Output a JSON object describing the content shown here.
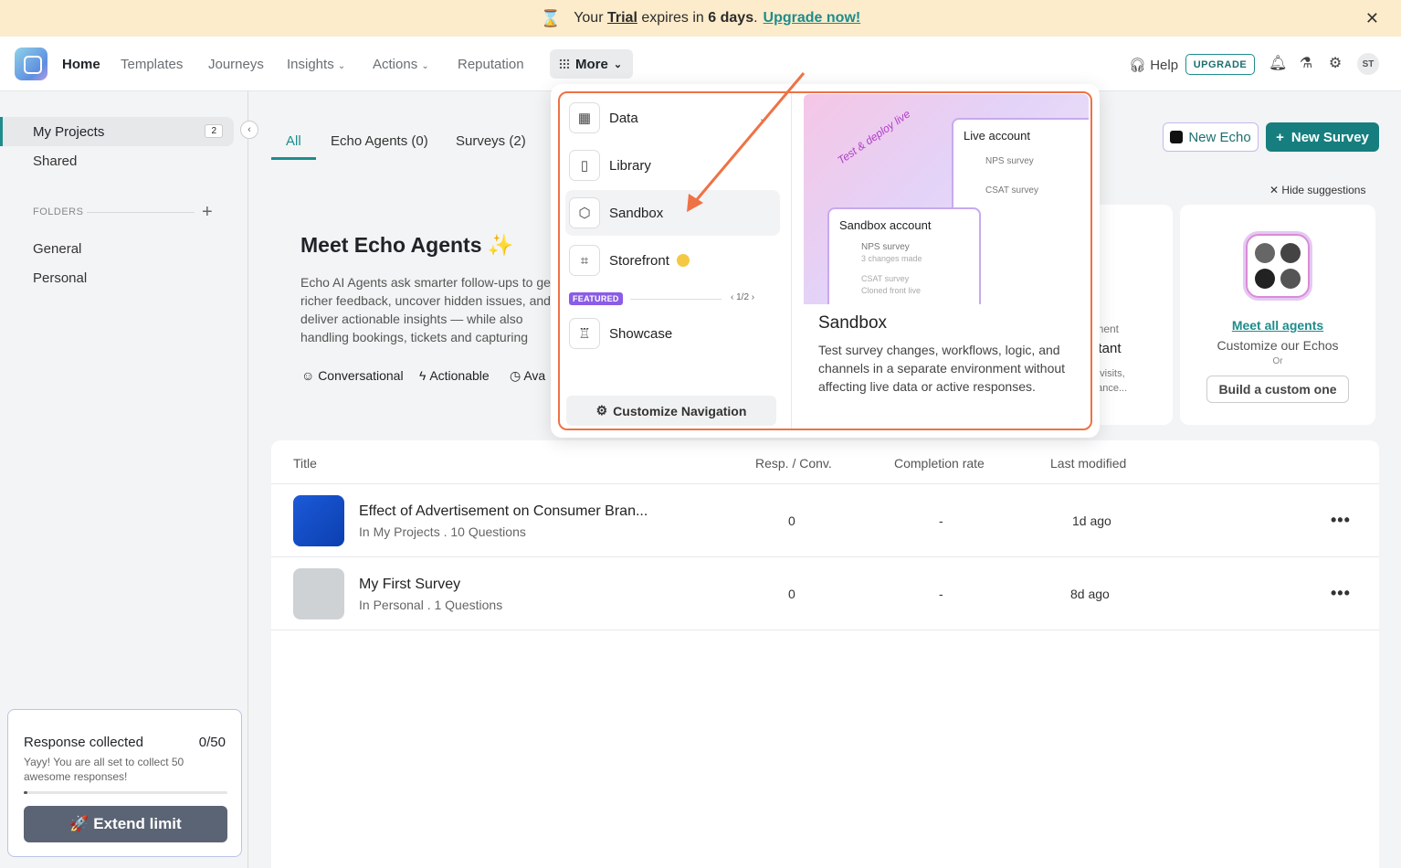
{
  "banner": {
    "your": "Your",
    "trial": "Trial",
    "expires": "expires in",
    "days": "6 days",
    "dot": ".",
    "upgrade_now": "Upgrade now!"
  },
  "nav": {
    "home": "Home",
    "templates": "Templates",
    "journeys": "Journeys",
    "insights": "Insights",
    "actions": "Actions",
    "reputation": "Reputation",
    "more": "More",
    "help": "Help",
    "upgrade": "UPGRADE",
    "avatar": "ST"
  },
  "sidebar": {
    "my_projects": "My Projects",
    "my_projects_count": "2",
    "shared": "Shared",
    "folders": "FOLDERS",
    "general": "General",
    "personal": "Personal"
  },
  "response_card": {
    "title": "Response collected",
    "count": "0/50",
    "desc": "Yayy! You are all set to collect 50 awesome responses!",
    "progress": 0.02,
    "button": "🚀 Extend limit"
  },
  "tabs": {
    "all": "All",
    "echo": "Echo Agents (0)",
    "surveys": "Surveys (2)"
  },
  "actions": {
    "new_echo": "New Echo",
    "new_survey": "New Survey",
    "hide": "Hide suggestions"
  },
  "echo": {
    "title": "Meet Echo Agents ✨",
    "desc": "Echo AI Agents ask smarter follow-ups to get richer feedback, uncover hidden issues, and deliver actionable insights — while also handling bookings, tickets and capturing leads.",
    "f1": "Conversational",
    "f2": "Actionable",
    "f3": "Ava"
  },
  "card2": {
    "l1": "tment",
    "l2": "stant",
    "l3": "e visits,",
    "l4": "nance..."
  },
  "meet": {
    "link": "Meet all agents",
    "sub": "Customize our Echos",
    "or": "Or",
    "btn": "Build a custom one"
  },
  "table": {
    "headers": {
      "title": "Title",
      "resp": "Resp. / Conv.",
      "completion": "Completion rate",
      "modified": "Last modified"
    },
    "rows": [
      {
        "title": "Effect of Advertisement on Consumer Bran...",
        "sub": "In My Projects . 10 Questions",
        "resp": "0",
        "completion": "-",
        "modified": "1d ago",
        "kebab": "•••"
      },
      {
        "title": "My First Survey",
        "sub": "In Personal . 1 Questions",
        "resp": "0",
        "completion": "-",
        "modified": "8d ago",
        "kebab": "•••"
      }
    ]
  },
  "dropdown": {
    "items": [
      "Data",
      "Library",
      "Sandbox",
      "Storefront"
    ],
    "featured": "FEATURED",
    "pager": "‹  1/2  ›",
    "showcase": "Showcase",
    "customize": "Customize Navigation",
    "preview": {
      "tagline": "Test & deploy live",
      "live": "Live account",
      "nps": "NPS survey",
      "csat": "CSAT survey",
      "sandbox": "Sandbox account",
      "changes": "3 changes made",
      "cloned": "Cloned front live",
      "title": "Sandbox",
      "desc": "Test survey changes, workflows, logic, and channels in a separate environment without affecting live data or active responses."
    }
  },
  "colors": {
    "accent": "#1e8c8c",
    "highlight": "#ee7246",
    "featured": "#8b5ce6"
  }
}
